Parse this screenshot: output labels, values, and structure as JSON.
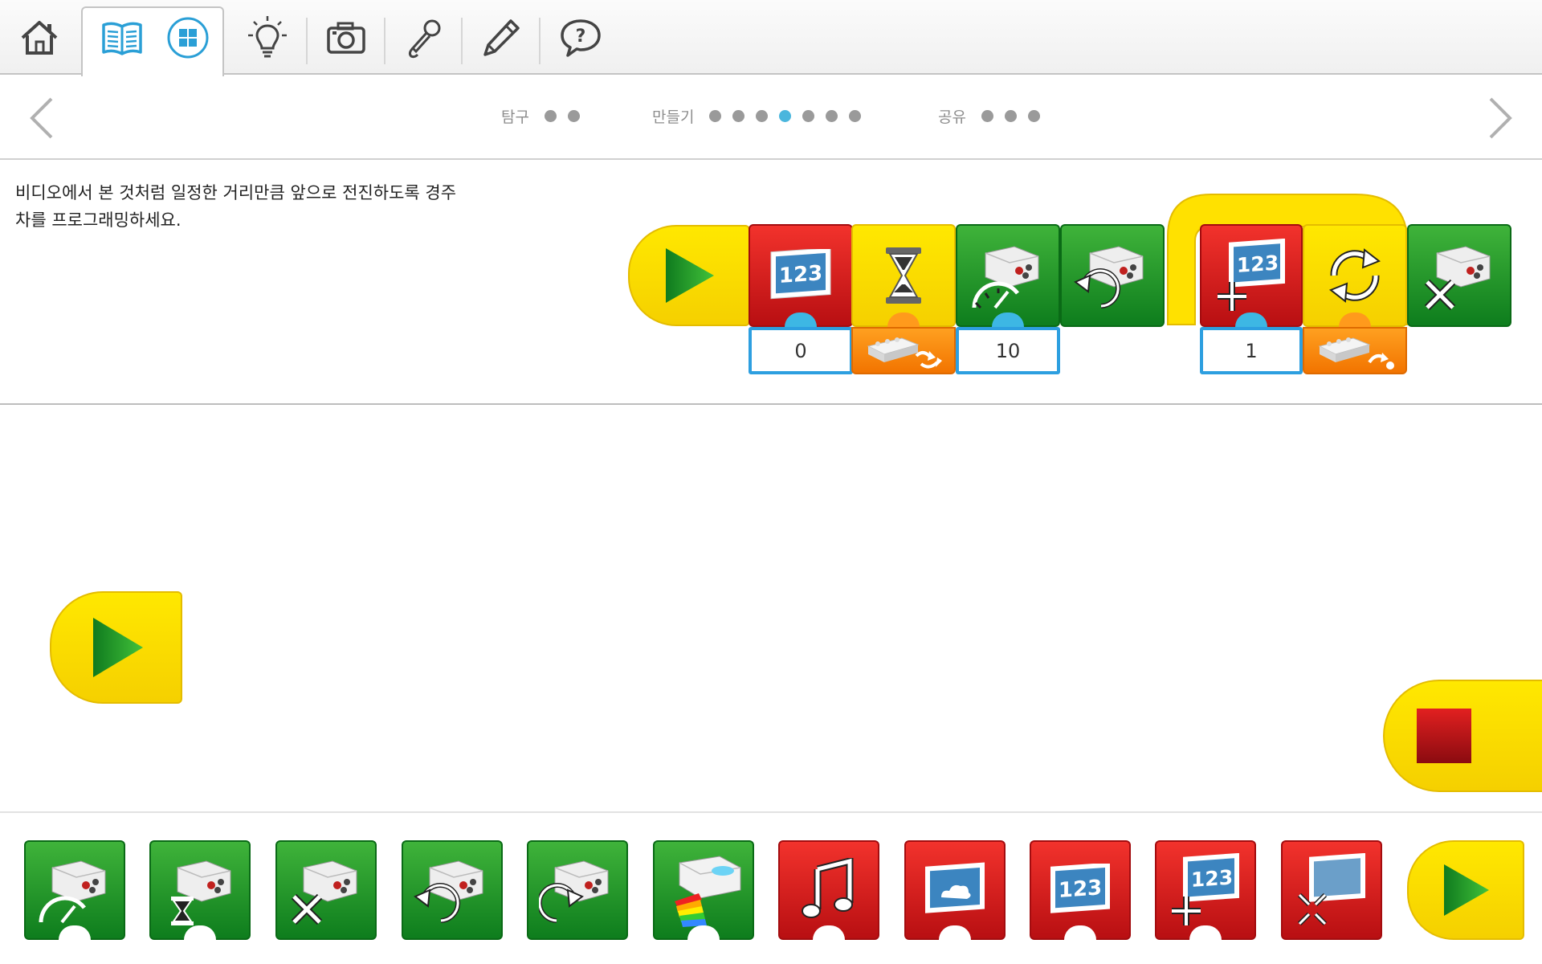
{
  "toolbar": {
    "items": [
      {
        "icon": "home-icon"
      },
      {
        "icon": "book-icon"
      },
      {
        "icon": "grid-icon"
      },
      {
        "icon": "lightbulb-icon"
      },
      {
        "icon": "camera-icon"
      },
      {
        "icon": "microphone-icon"
      },
      {
        "icon": "pencil-icon"
      },
      {
        "icon": "help-icon"
      }
    ]
  },
  "progress": {
    "groups": [
      {
        "label": "탐구",
        "dots": 2,
        "active": -1
      },
      {
        "label": "만들기",
        "dots": 7,
        "active": 3
      },
      {
        "label": "공유",
        "dots": 3,
        "active": -1
      }
    ]
  },
  "instruction": {
    "line1": "비디오에서 본 것처럼 일정한 거리만큼 앞으로 전진하도록 경주",
    "line2": "차를 프로그래밍하세요."
  },
  "program": {
    "display_number_value": "0",
    "motor_power_value": "10",
    "add_to_display_value": "1"
  },
  "colors": {
    "green": "#1f9a2a",
    "red": "#e0201e",
    "yellow": "#ffe100",
    "orange": "#ff8a10",
    "param_border": "#2d9fe0",
    "active_dot": "#4ab6dd"
  },
  "palette": {
    "blocks": [
      {
        "icon": "motor-power-icon",
        "color": "green"
      },
      {
        "icon": "motor-time-icon",
        "color": "green"
      },
      {
        "icon": "motor-stop-icon",
        "color": "green"
      },
      {
        "icon": "motor-counterclockwise-icon",
        "color": "green"
      },
      {
        "icon": "motor-clockwise-icon",
        "color": "green"
      },
      {
        "icon": "hub-light-icon",
        "color": "green"
      },
      {
        "icon": "music-note-icon",
        "color": "red"
      },
      {
        "icon": "display-image-icon",
        "color": "red"
      },
      {
        "icon": "display-number-icon",
        "color": "red"
      },
      {
        "icon": "display-add-number-icon",
        "color": "red"
      },
      {
        "icon": "display-shrink-icon",
        "color": "red"
      },
      {
        "icon": "start-play-icon",
        "color": "yellow"
      }
    ]
  }
}
